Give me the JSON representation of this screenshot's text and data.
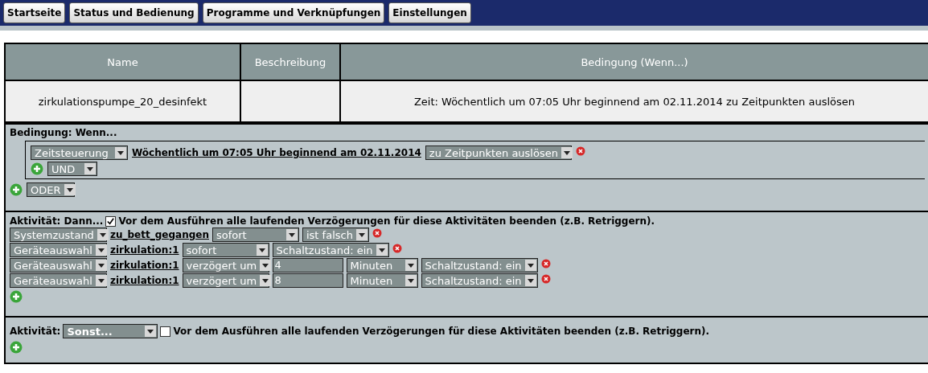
{
  "nav": [
    "Startseite",
    "Status und Bedienung",
    "Programme und Verknüpfungen",
    "Einstellungen"
  ],
  "table": {
    "columns": [
      "Name",
      "Beschreibung",
      "Bedingung (Wenn...)"
    ],
    "rows": [
      {
        "name": "zirkulationspumpe_20_desinfekt",
        "condition": "Zeit: Wöchentlich um 07:05 Uhr beginnend am 02.11.2014 zu Zeitpunkten auslösen"
      }
    ]
  },
  "condition_section": {
    "title": "Bedingung: Wenn...",
    "groups": [
      {
        "rules": [
          {
            "parts": [
              {
                "kind": "source",
                "text": "Zeitsteuerung"
              },
              {
                "kind": "link",
                "text": "Wöchentlich um 07:05 Uhr beginnend am 02.11.2014"
              },
              {
                "kind": "trigger",
                "text": "zu Zeitpunkten auslösen"
              }
            ]
          }
        ],
        "and_select": "UND"
      }
    ],
    "or_select": "ODER"
  },
  "activity_then": {
    "title": "Aktivität: Dann...",
    "retrigger": {
      "checked": true,
      "label": "Vor dem Ausführen alle laufenden Verzögerungen für diese Aktivitäten beenden (z.B. Retriggern)."
    },
    "actions": [
      {
        "parts": [
          {
            "kind": "source",
            "text": "Systemzustand"
          },
          {
            "kind": "link",
            "text": "zu_bett_gegangen"
          },
          {
            "kind": "timing",
            "text": "sofort"
          },
          {
            "kind": "state",
            "text": "ist falsch"
          }
        ]
      },
      {
        "parts": [
          {
            "kind": "source",
            "text": "Geräteauswahl"
          },
          {
            "kind": "link",
            "text": "zirkulation:1"
          },
          {
            "kind": "timing",
            "text": "sofort"
          },
          {
            "kind": "state",
            "text": "Schaltzustand: ein"
          }
        ]
      },
      {
        "parts": [
          {
            "kind": "source",
            "text": "Geräteauswahl"
          },
          {
            "kind": "link",
            "text": "zirkulation:1"
          },
          {
            "kind": "timing",
            "text": "verzögert um"
          },
          {
            "kind": "value",
            "text": "4"
          },
          {
            "kind": "unit",
            "text": "Minuten"
          },
          {
            "kind": "state",
            "text": "Schaltzustand: ein"
          }
        ]
      },
      {
        "parts": [
          {
            "kind": "source",
            "text": "Geräteauswahl"
          },
          {
            "kind": "link",
            "text": "zirkulation:1"
          },
          {
            "kind": "timing",
            "text": "verzögert um"
          },
          {
            "kind": "value",
            "text": "8"
          },
          {
            "kind": "unit",
            "text": "Minuten"
          },
          {
            "kind": "state",
            "text": "Schaltzustand: ein"
          }
        ]
      }
    ]
  },
  "activity_else": {
    "title": "Aktivität:",
    "select": "Sonst...",
    "retrigger": {
      "checked": false,
      "label": "Vor dem Ausführen alle laufenden Verzögerungen für diese Aktivitäten beenden (z.B. Retriggern)."
    }
  }
}
